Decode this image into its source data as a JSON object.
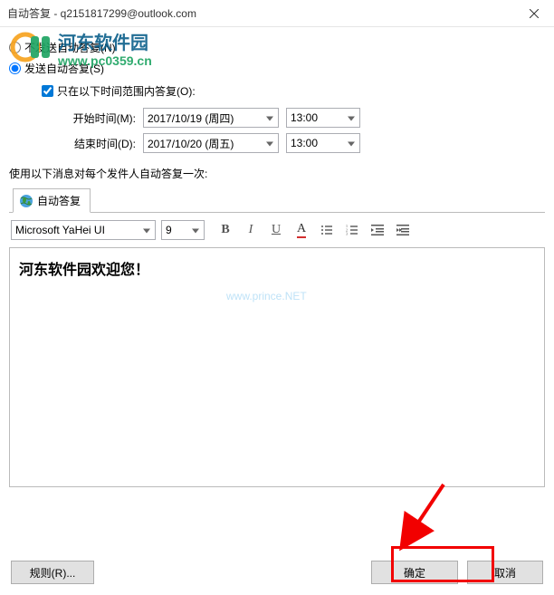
{
  "window": {
    "title": "自动答复 - q2151817299@outlook.com"
  },
  "radios": {
    "dont_send": "不发送自动答复(N)",
    "send": "发送自动答复(S)"
  },
  "time_range": {
    "checkbox_label": "只在以下时间范围内答复(O):",
    "start_label": "开始时间(M):",
    "start_date": "2017/10/19 (周四)",
    "start_time": "13:00",
    "end_label": "结束时间(D):",
    "end_date": "2017/10/20 (周五)",
    "end_time": "13:00"
  },
  "section_label": "使用以下消息对每个发件人自动答复一次:",
  "tab": {
    "label": "自动答复"
  },
  "toolbar": {
    "font_family": "Microsoft YaHei UI",
    "font_size": "9"
  },
  "editor": {
    "message": "河东软件园欢迎您！"
  },
  "buttons": {
    "rules": "规则(R)...",
    "ok": "确定",
    "cancel": "取消"
  },
  "watermark": {
    "brand": "河东软件园",
    "url": "www.pc0359.cn",
    "faint": "www.prince.NET"
  }
}
